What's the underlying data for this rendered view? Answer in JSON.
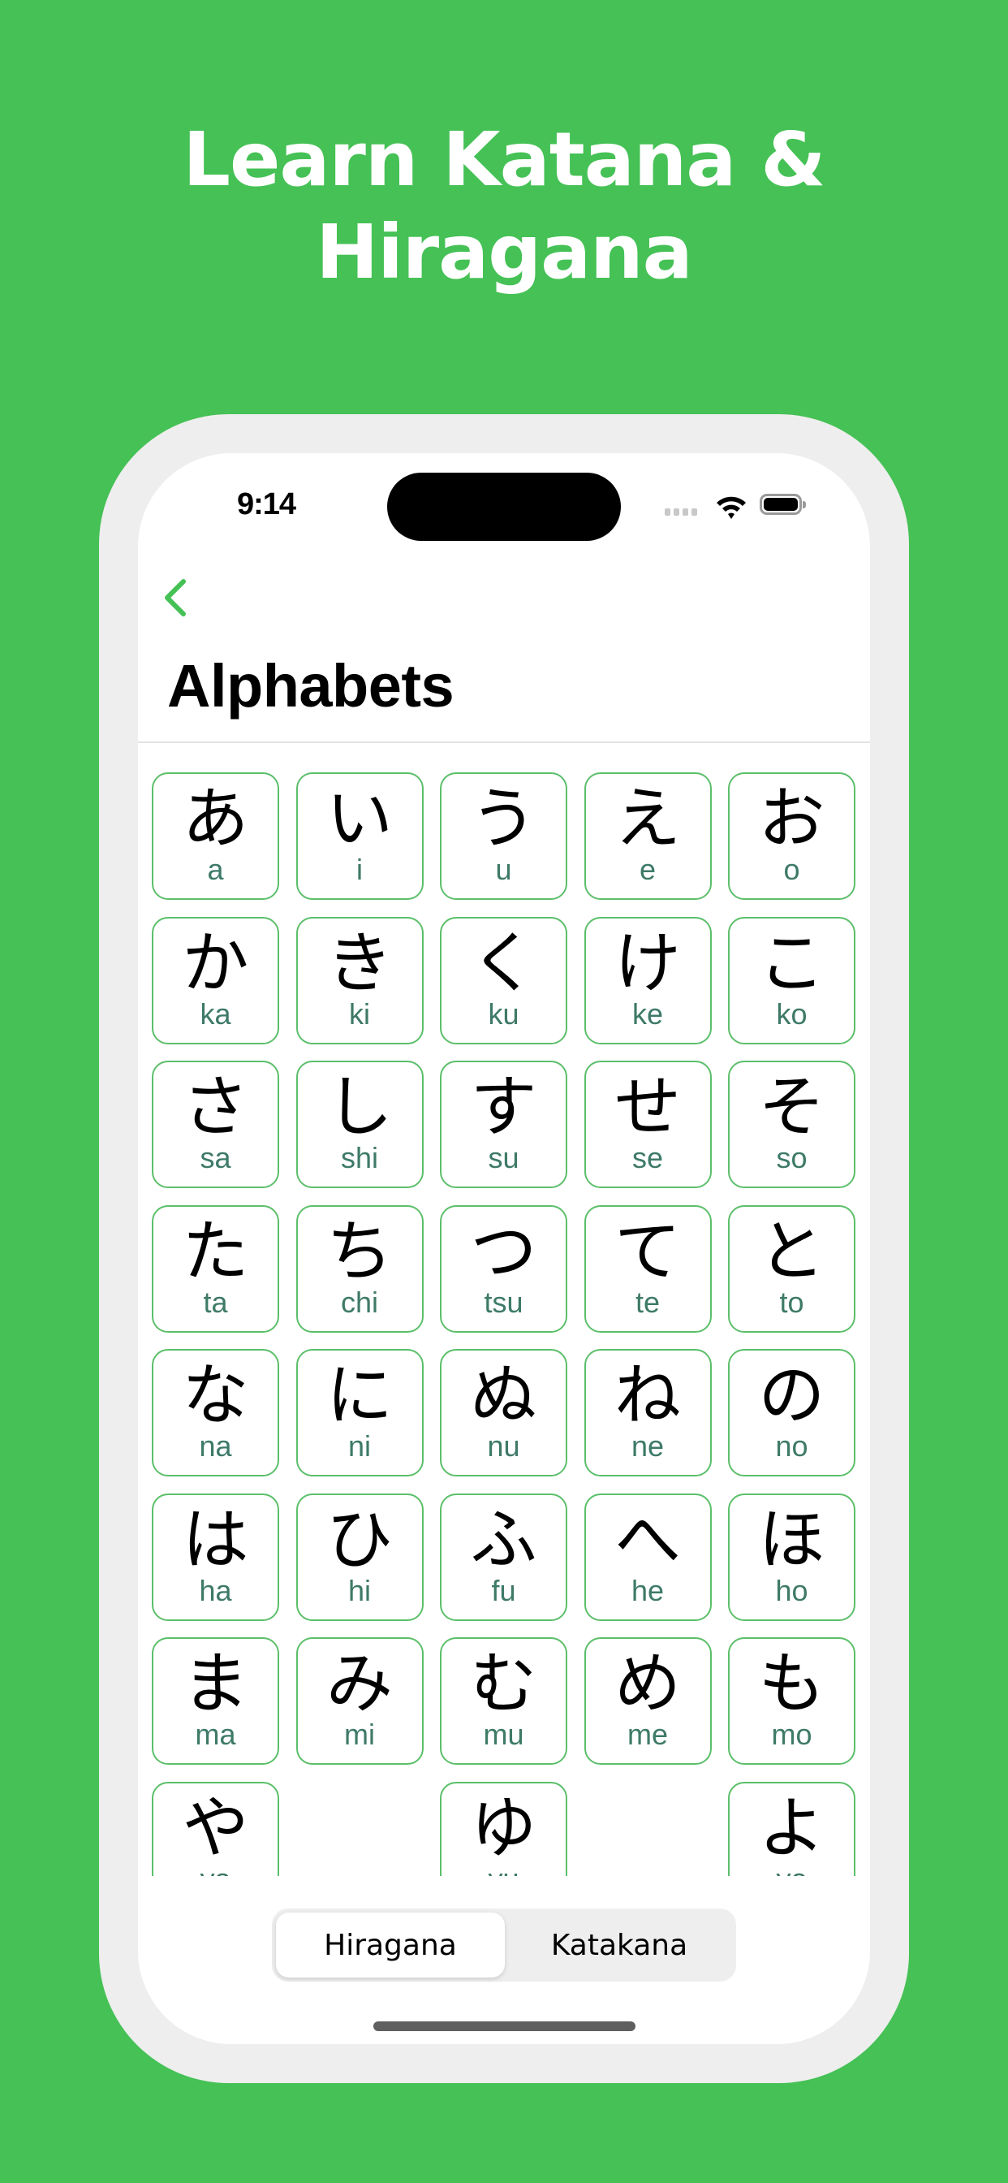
{
  "promo": {
    "headline_line1": "Learn Katana &",
    "headline_line2": "Hiragana"
  },
  "status_bar": {
    "time": "9:14",
    "icons": [
      "cellular-signal-icon",
      "wifi-icon",
      "battery-icon"
    ]
  },
  "nav": {
    "back_icon": "chevron-left-icon",
    "title": "Alphabets"
  },
  "colors": {
    "background": "#45C155",
    "accent": "#45C155",
    "card_border": "#5CBF6A",
    "romaji_text": "#3E7A68"
  },
  "grid": {
    "rows": [
      [
        {
          "kana": "あ",
          "romaji": "a"
        },
        {
          "kana": "い",
          "romaji": "i"
        },
        {
          "kana": "う",
          "romaji": "u"
        },
        {
          "kana": "え",
          "romaji": "e"
        },
        {
          "kana": "お",
          "romaji": "o"
        }
      ],
      [
        {
          "kana": "か",
          "romaji": "ka"
        },
        {
          "kana": "き",
          "romaji": "ki"
        },
        {
          "kana": "く",
          "romaji": "ku"
        },
        {
          "kana": "け",
          "romaji": "ke"
        },
        {
          "kana": "こ",
          "romaji": "ko"
        }
      ],
      [
        {
          "kana": "さ",
          "romaji": "sa"
        },
        {
          "kana": "し",
          "romaji": "shi"
        },
        {
          "kana": "す",
          "romaji": "su"
        },
        {
          "kana": "せ",
          "romaji": "se"
        },
        {
          "kana": "そ",
          "romaji": "so"
        }
      ],
      [
        {
          "kana": "た",
          "romaji": "ta"
        },
        {
          "kana": "ち",
          "romaji": "chi"
        },
        {
          "kana": "つ",
          "romaji": "tsu"
        },
        {
          "kana": "て",
          "romaji": "te"
        },
        {
          "kana": "と",
          "romaji": "to"
        }
      ],
      [
        {
          "kana": "な",
          "romaji": "na"
        },
        {
          "kana": "に",
          "romaji": "ni"
        },
        {
          "kana": "ぬ",
          "romaji": "nu"
        },
        {
          "kana": "ね",
          "romaji": "ne"
        },
        {
          "kana": "の",
          "romaji": "no"
        }
      ],
      [
        {
          "kana": "は",
          "romaji": "ha"
        },
        {
          "kana": "ひ",
          "romaji": "hi"
        },
        {
          "kana": "ふ",
          "romaji": "fu"
        },
        {
          "kana": "へ",
          "romaji": "he"
        },
        {
          "kana": "ほ",
          "romaji": "ho"
        }
      ],
      [
        {
          "kana": "ま",
          "romaji": "ma"
        },
        {
          "kana": "み",
          "romaji": "mi"
        },
        {
          "kana": "む",
          "romaji": "mu"
        },
        {
          "kana": "め",
          "romaji": "me"
        },
        {
          "kana": "も",
          "romaji": "mo"
        }
      ],
      [
        {
          "kana": "や",
          "romaji": "ya"
        },
        null,
        {
          "kana": "ゆ",
          "romaji": "yu"
        },
        null,
        {
          "kana": "よ",
          "romaji": "yo"
        }
      ]
    ]
  },
  "segmented_control": {
    "options": [
      "Hiragana",
      "Katakana"
    ],
    "selected": "Hiragana"
  }
}
